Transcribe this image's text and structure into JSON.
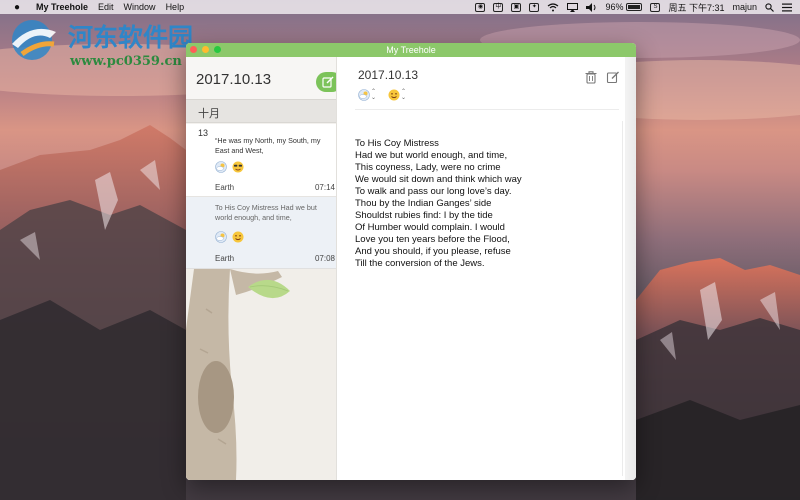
{
  "menubar": {
    "app_name": "My Treehole",
    "menus": [
      "Edit",
      "Window",
      "Help"
    ],
    "status": {
      "battery": "96%",
      "battery_level": 0.96,
      "datetime": "周五 下午7:31",
      "user": "majun"
    }
  },
  "watermark": {
    "title": "河东软件园",
    "url": "www.pc0359.cn"
  },
  "window": {
    "title": "My Treehole"
  },
  "sidebar": {
    "date": "2017.10.13",
    "month": "十月",
    "entries": [
      {
        "day": "13",
        "preview": "“He was my North, my South, my East and West,",
        "weather_icon": "cloud-sun-icon",
        "mood_icon": "cool-smiley-icon",
        "location": "Earth",
        "time": "07:14"
      },
      {
        "preview": "To His Coy Mistress Had we but world enough, and time,",
        "weather_icon": "cloud-sun-icon",
        "mood_icon": "smiley-icon",
        "location": "Earth",
        "time": "07:08"
      }
    ]
  },
  "detail": {
    "date": "2017.10.13",
    "weather_icon": "cloud-sun-icon",
    "mood_icon": "smiley-icon",
    "lines": [
      "To His Coy Mistress",
      "Had we but world enough, and time,",
      "This coyness, Lady, were no crime",
      "We would sit down and think which way",
      "To walk and pass our long love’s day.",
      "Thou by the Indian Ganges’ side",
      "Shouldst rubies find: I by the tide",
      "Of Humber would complain. I would",
      "Love you ten years before the Flood,",
      "And you should, if you please, refuse",
      "Till the conversion of the Jews."
    ]
  },
  "colors": {
    "titlebar": "#8cc86a",
    "accent": "#7cc35a"
  }
}
